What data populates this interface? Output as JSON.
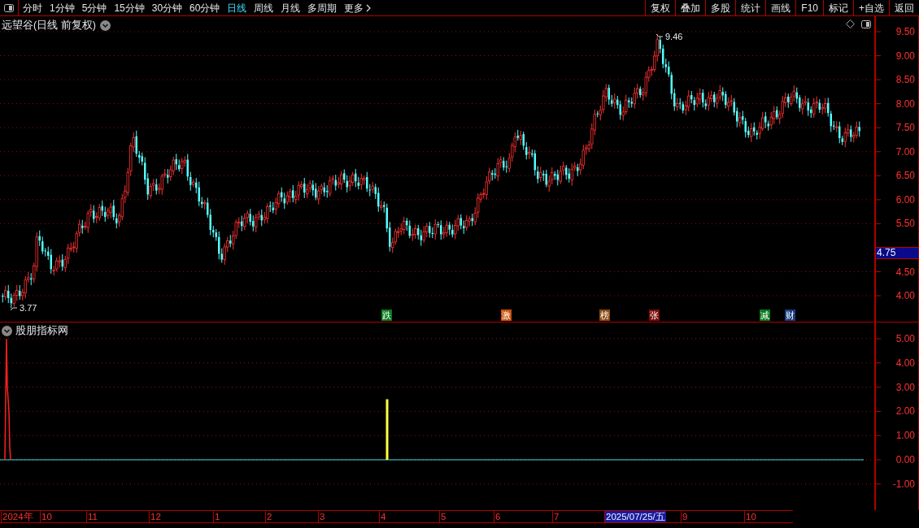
{
  "toolbar": {
    "periods": [
      {
        "label": "分时",
        "selected": false
      },
      {
        "label": "1分钟",
        "selected": false
      },
      {
        "label": "5分钟",
        "selected": false
      },
      {
        "label": "15分钟",
        "selected": false
      },
      {
        "label": "30分钟",
        "selected": false
      },
      {
        "label": "60分钟",
        "selected": false
      },
      {
        "label": "日线",
        "selected": true
      },
      {
        "label": "周线",
        "selected": false
      },
      {
        "label": "月线",
        "selected": false
      },
      {
        "label": "多周期",
        "selected": false
      },
      {
        "label": "更多",
        "selected": false
      }
    ],
    "buttons": [
      "复权",
      "叠加",
      "多股",
      "统计",
      "画线",
      "F10",
      "标记",
      "+自选",
      "返回"
    ]
  },
  "price_chart": {
    "title": "远望谷(日线 前复权)",
    "high_label": "9.46",
    "low_label": "3.77",
    "current_price": "4.75",
    "ticks": [
      "9.50",
      "9.00",
      "8.50",
      "8.00",
      "7.50",
      "7.00",
      "6.50",
      "6.00",
      "5.50",
      "4.50",
      "4.00"
    ],
    "events": [
      {
        "label": "跌",
        "color": "#0a7a1e"
      },
      {
        "label": "激",
        "color": "#c8500a"
      },
      {
        "label": "榜",
        "color": "#8a4a10"
      },
      {
        "label": "张",
        "color": "#7a0a0a"
      },
      {
        "label": "减",
        "color": "#0a7a1e"
      },
      {
        "label": "财",
        "color": "#1a3f80"
      }
    ]
  },
  "indicator": {
    "title": "股朋指标网",
    "ticks": [
      "5.00",
      "4.00",
      "3.00",
      "2.00",
      "1.00",
      "0.00",
      "-1.00"
    ]
  },
  "date_axis": [
    {
      "label": "2024年",
      "selected": false
    },
    {
      "label": "10",
      "selected": false
    },
    {
      "label": "11",
      "selected": false
    },
    {
      "label": "12",
      "selected": false
    },
    {
      "label": "1",
      "selected": false
    },
    {
      "label": "2",
      "selected": false
    },
    {
      "label": "3",
      "selected": false
    },
    {
      "label": "4",
      "selected": false
    },
    {
      "label": "5",
      "selected": false
    },
    {
      "label": "6",
      "selected": false
    },
    {
      "label": "7",
      "selected": false
    },
    {
      "label": "2025/07/25/五",
      "selected": true
    },
    {
      "label": "9",
      "selected": false
    },
    {
      "label": "10",
      "selected": false
    }
  ]
}
